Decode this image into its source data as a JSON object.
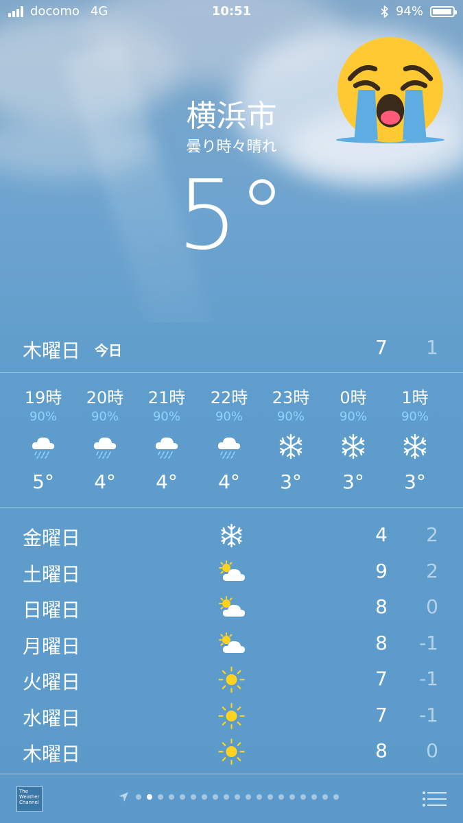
{
  "status_bar": {
    "carrier": "docomo",
    "network": "4G",
    "time": "10:51",
    "battery": "94%"
  },
  "location": {
    "city": "横浜市",
    "condition": "曇り時々晴れ",
    "temperature": "5°"
  },
  "today": {
    "day": "木曜日",
    "tag": "今日",
    "high": "7",
    "low": "1"
  },
  "hourly": [
    {
      "hour": "19時",
      "precip": "90%",
      "icon": "rain-cloud-icon",
      "temp": "5°"
    },
    {
      "hour": "20時",
      "precip": "90%",
      "icon": "rain-cloud-icon",
      "temp": "4°"
    },
    {
      "hour": "21時",
      "precip": "90%",
      "icon": "rain-cloud-icon",
      "temp": "4°"
    },
    {
      "hour": "22時",
      "precip": "90%",
      "icon": "rain-cloud-icon",
      "temp": "4°"
    },
    {
      "hour": "23時",
      "precip": "90%",
      "icon": "snowflake-icon",
      "temp": "3°"
    },
    {
      "hour": "0時",
      "precip": "90%",
      "icon": "snowflake-icon",
      "temp": "3°"
    },
    {
      "hour": "1時",
      "precip": "90%",
      "icon": "snowflake-icon",
      "temp": "3°"
    }
  ],
  "daily": [
    {
      "day": "金曜日",
      "icon": "snowflake-icon",
      "high": "4",
      "low": "2"
    },
    {
      "day": "土曜日",
      "icon": "partly-sunny-icon",
      "high": "9",
      "low": "2"
    },
    {
      "day": "日曜日",
      "icon": "partly-sunny-icon",
      "high": "8",
      "low": "0"
    },
    {
      "day": "月曜日",
      "icon": "partly-sunny-icon",
      "high": "8",
      "low": "-1"
    },
    {
      "day": "火曜日",
      "icon": "sun-icon",
      "high": "7",
      "low": "-1"
    },
    {
      "day": "水曜日",
      "icon": "sun-icon",
      "high": "7",
      "low": "-1"
    },
    {
      "day": "木曜日",
      "icon": "sun-icon",
      "high": "8",
      "low": "0"
    }
  ],
  "footer": {
    "logo_text": "The Weather Channel",
    "page_count": 19,
    "active_page": 2
  },
  "colors": {
    "precip_text": "#8fd3ff",
    "sun": "#ffd21f",
    "emoji_face": "#ffc933",
    "emoji_tears": "#5dade2"
  }
}
